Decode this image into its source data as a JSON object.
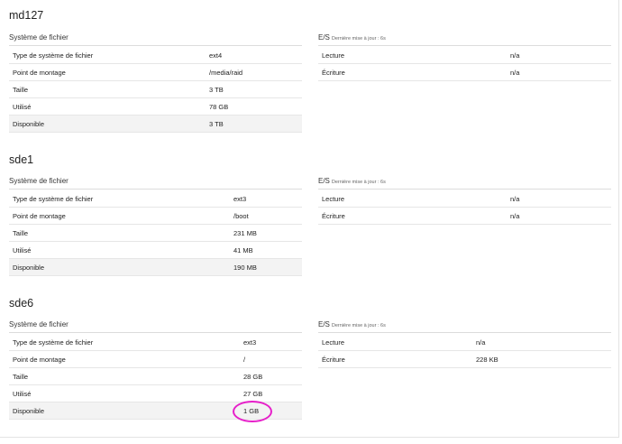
{
  "disks": [
    {
      "name": "md127",
      "filesystem_heading": "Système de fichier",
      "io_heading": "E/S",
      "io_updated": "Dernière mise à jour : 6s",
      "fs_rows": [
        {
          "label": "Type de système de fichier",
          "value": "ext4"
        },
        {
          "label": "Point de montage",
          "value": "/media/raid"
        },
        {
          "label": "Taille",
          "value": "3 TB"
        },
        {
          "label": "Utilisé",
          "value": "78 GB"
        },
        {
          "label": "Disponible",
          "value": "3 TB"
        }
      ],
      "io_rows": [
        {
          "label": "Lecture",
          "value": "n/a"
        },
        {
          "label": "Écriture",
          "value": "n/a"
        }
      ]
    },
    {
      "name": "sde1",
      "filesystem_heading": "Système de fichier",
      "io_heading": "E/S",
      "io_updated": "Dernière mise à jour : 6s",
      "fs_rows": [
        {
          "label": "Type de système de fichier",
          "value": "ext3"
        },
        {
          "label": "Point de montage",
          "value": "/boot"
        },
        {
          "label": "Taille",
          "value": "231 MB"
        },
        {
          "label": "Utilisé",
          "value": "41 MB"
        },
        {
          "label": "Disponible",
          "value": "190 MB"
        }
      ],
      "io_rows": [
        {
          "label": "Lecture",
          "value": "n/a"
        },
        {
          "label": "Écriture",
          "value": "n/a"
        }
      ]
    },
    {
      "name": "sde6",
      "filesystem_heading": "Système de fichier",
      "io_heading": "E/S",
      "io_updated": "Dernière mise à jour : 6s",
      "fs_rows": [
        {
          "label": "Type de système de fichier",
          "value": "ext3"
        },
        {
          "label": "Point de montage",
          "value": "/"
        },
        {
          "label": "Taille",
          "value": "28 GB"
        },
        {
          "label": "Utilisé",
          "value": "27 GB"
        },
        {
          "label": "Disponible",
          "value": "1 GB"
        }
      ],
      "io_rows": [
        {
          "label": "Lecture",
          "value": "n/a"
        },
        {
          "label": "Écriture",
          "value": "228 KB"
        }
      ]
    }
  ],
  "annotation_color": "#e61fc9"
}
